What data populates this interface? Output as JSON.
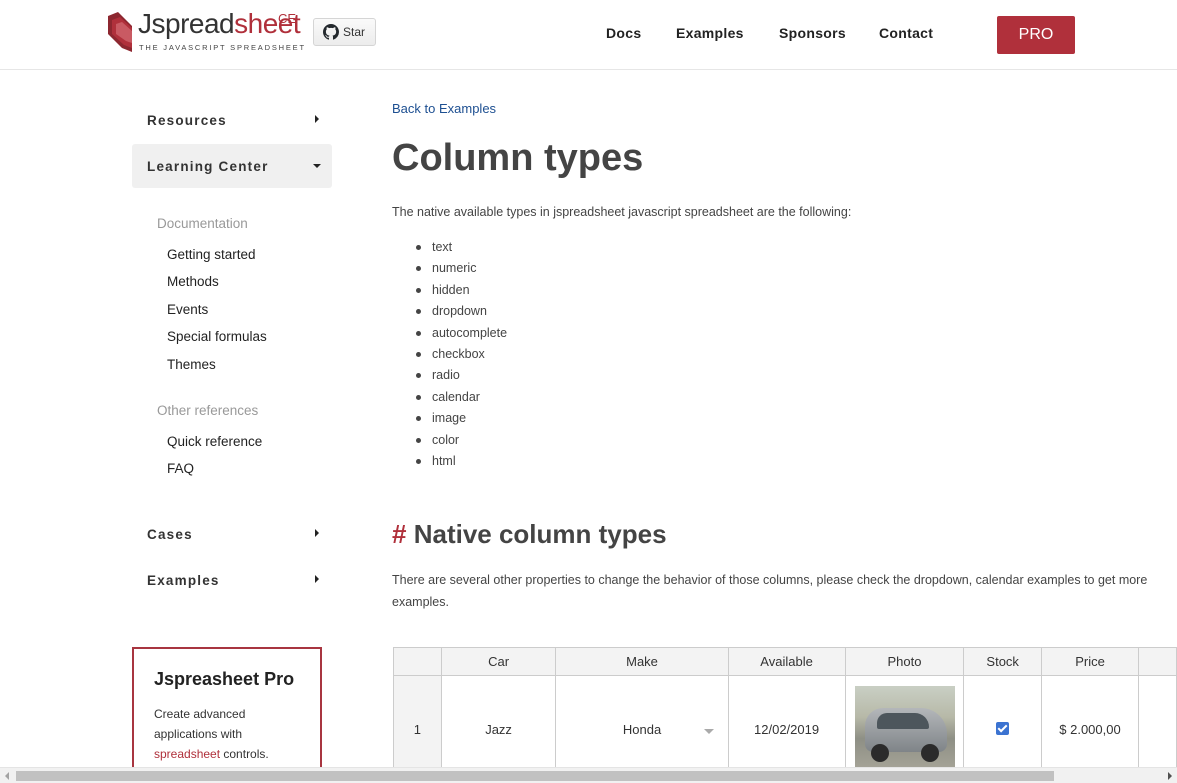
{
  "header": {
    "logo": {
      "name": "Jspreadsheet",
      "part1": "Jspread",
      "part2": "sheet",
      "edition": "CE",
      "tagline": "THE JAVASCRIPT SPREADSHEET"
    },
    "star_label": "Star",
    "nav": [
      "Docs",
      "Examples",
      "Sponsors",
      "Contact"
    ],
    "pro_label": "PRO"
  },
  "sidebar": {
    "sections": [
      {
        "label": "Resources",
        "expanded": false
      },
      {
        "label": "Learning Center",
        "expanded": true
      },
      {
        "label": "Cases",
        "expanded": false
      },
      {
        "label": "Examples",
        "expanded": false
      }
    ],
    "groups": [
      {
        "title": "Documentation",
        "links": [
          "Getting started",
          "Methods",
          "Events",
          "Special formulas",
          "Themes"
        ]
      },
      {
        "title": "Other references",
        "links": [
          "Quick reference",
          "FAQ"
        ]
      }
    ],
    "promo": {
      "title": "Jspreasheet Pro",
      "text_before": "Create advanced applications with ",
      "link": "spreadsheet",
      "text_after": " controls."
    }
  },
  "main": {
    "back_link": "Back to Examples",
    "title": "Column types",
    "intro": "The native available types in jspreadsheet javascript spreadsheet are the following:",
    "types": [
      "text",
      "numeric",
      "hidden",
      "dropdown",
      "autocomplete",
      "checkbox",
      "radio",
      "calendar",
      "image",
      "color",
      "html"
    ],
    "section_hash": "#",
    "section_title": "Native column types",
    "section_text": "There are several other properties to change the behavior of those columns, please check the dropdown, calendar examples to get more examples."
  },
  "table": {
    "headers": [
      "",
      "Car",
      "Make",
      "Available",
      "Photo",
      "Stock",
      "Price",
      ""
    ],
    "rows": [
      {
        "num": "1",
        "car": "Jazz",
        "make": "Honda",
        "available": "12/02/2019",
        "photo": "car-photo",
        "stock": true,
        "price": "$ 2.000,00"
      }
    ]
  },
  "colors": {
    "brand": "#b0303b",
    "link": "#1d4f91",
    "checkbox": "#3b73d1"
  }
}
